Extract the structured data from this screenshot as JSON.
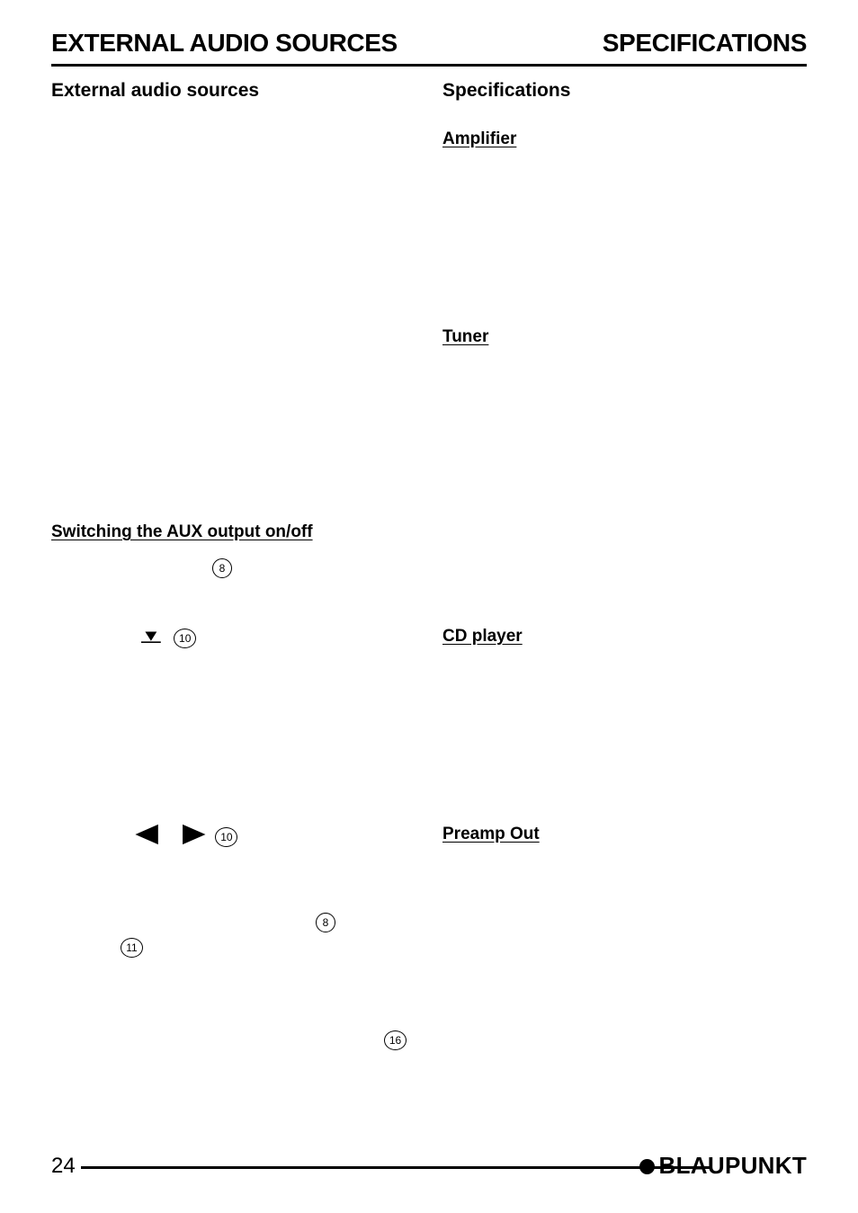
{
  "document": {
    "running_head": {
      "left": "EXTERNAL AUDIO SOURCES",
      "right": "SPECIFICATIONS"
    },
    "left_column": {
      "title": "External audio sources",
      "section_heading": "Switching the AUX output on/off",
      "callouts": {
        "menu_button": "8",
        "down_button": "10",
        "left_right_buttons": "10",
        "menu_button_2": "8",
        "ok_button": "11",
        "display_marker": "16"
      },
      "glyphs": {
        "down_arrow": "▼",
        "left_arrow": "◀",
        "right_arrow": "▶"
      }
    },
    "right_column": {
      "title": "Specifications",
      "headings": [
        "Amplifier",
        "Tuner",
        "CD player",
        "Preamp Out"
      ]
    },
    "footer": {
      "page_number": "24",
      "brand": "BLAUPUNKT"
    }
  }
}
